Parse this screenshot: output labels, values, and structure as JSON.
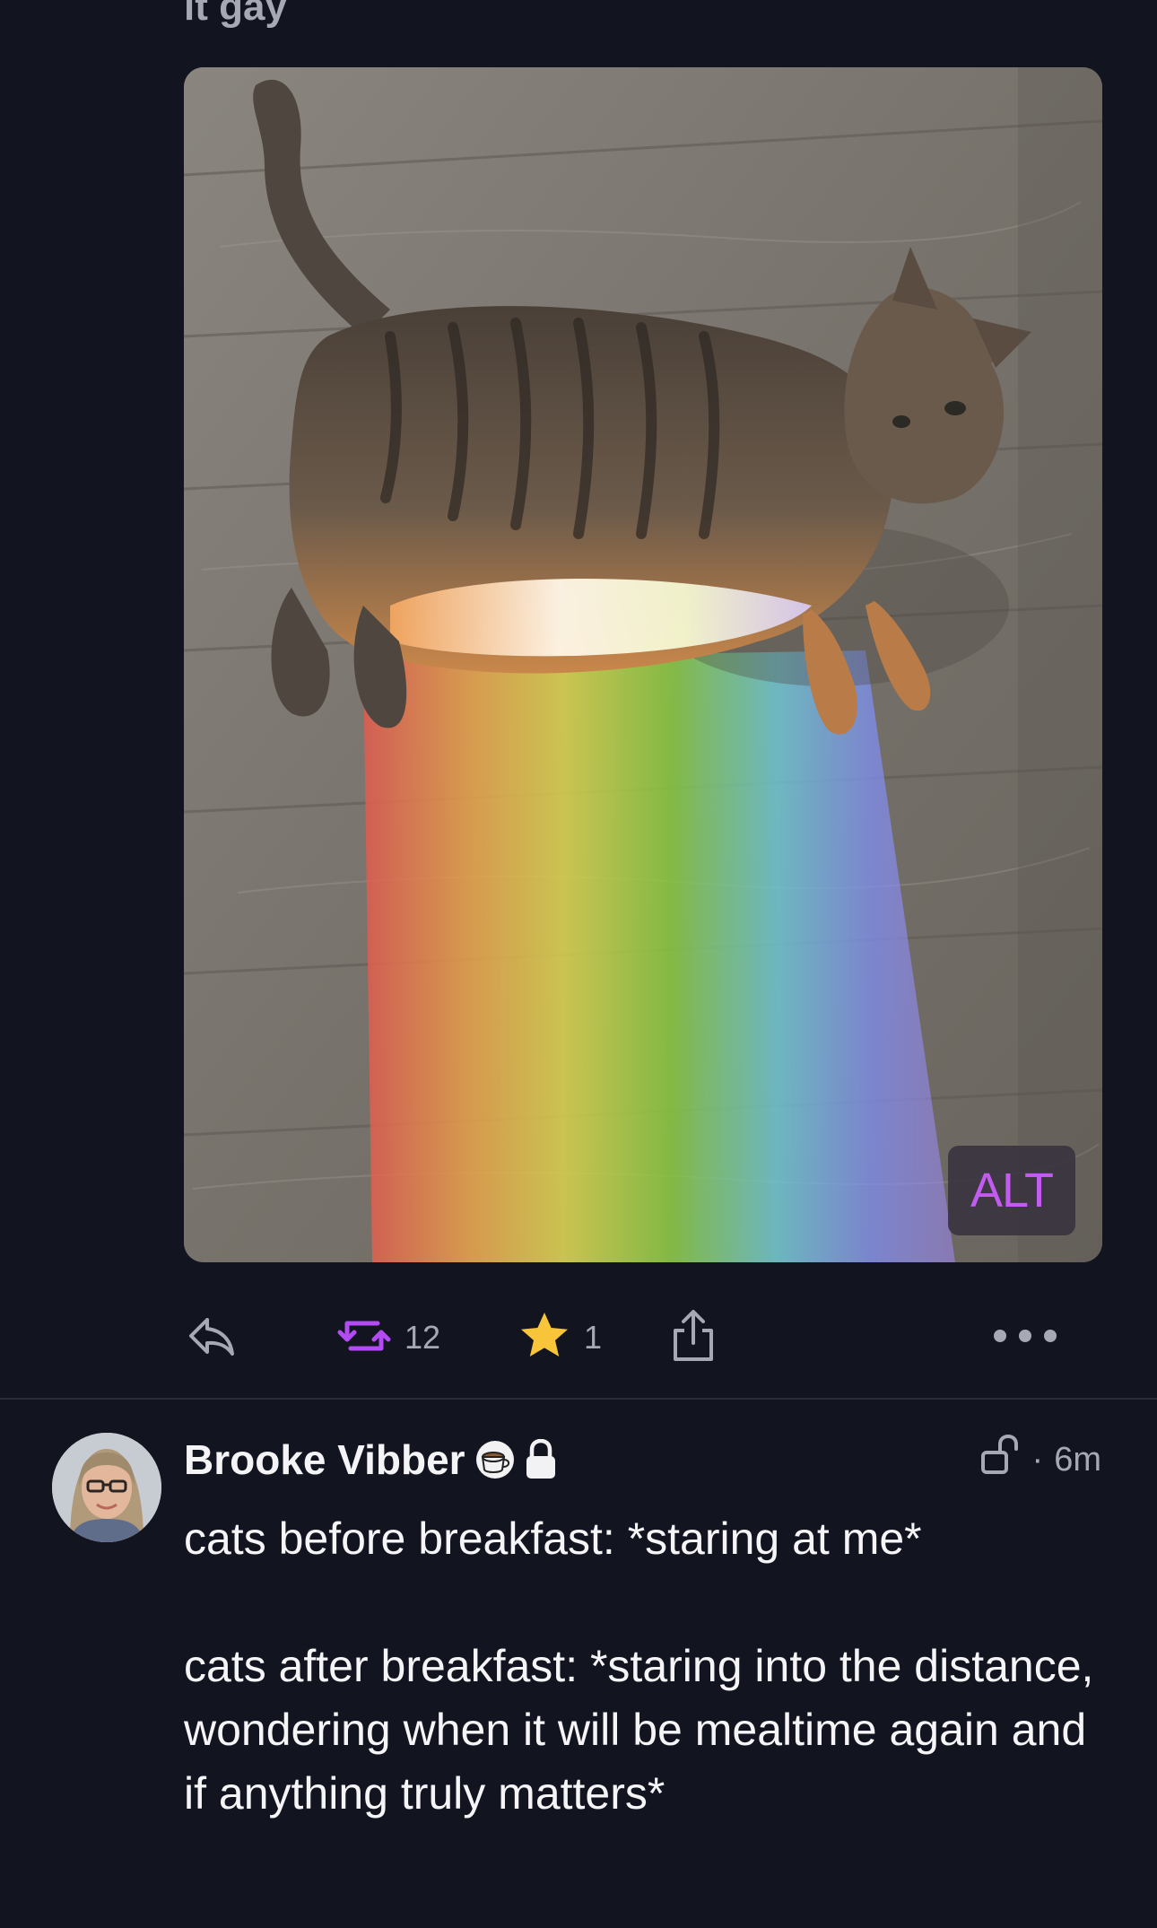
{
  "previous_post": {
    "text_cut": "it gay",
    "media": {
      "alt_badge": "ALT"
    },
    "actions": {
      "boost_count": "12",
      "favorite_count": "1"
    },
    "colors": {
      "boost_accent": "#b24bf3",
      "favorite_accent": "#f7c43a",
      "alt_text": "#c45bf0"
    }
  },
  "post": {
    "author_name": "Brooke Vibber",
    "author_emoji_icon": "coffee-cup-icon",
    "author_lock_icon": "lock-icon",
    "visibility_icon": "unlocked-icon",
    "separator": "·",
    "time": "6m",
    "paragraphs": [
      "cats before breakfast: *staring at me*",
      "cats after breakfast: *staring into the distance, wondering when it will be mealtime again and if anything truly matters*"
    ]
  },
  "theme": {
    "background": "#12141f",
    "text": "#f2f2f5",
    "muted": "#a6a8b3"
  }
}
